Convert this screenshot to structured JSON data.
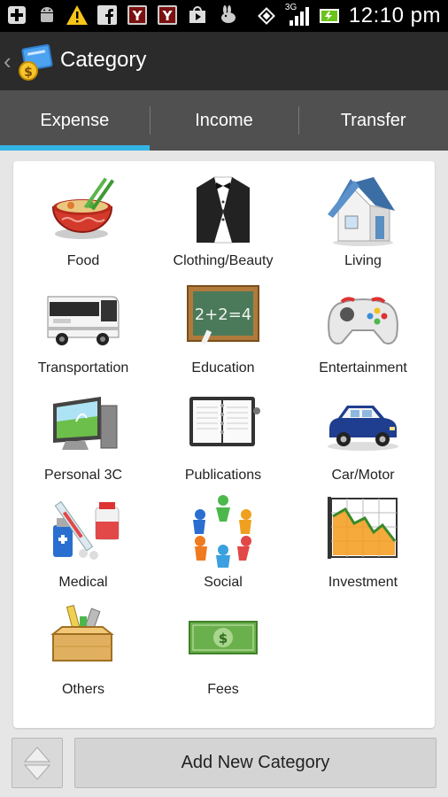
{
  "status_bar": {
    "time": "12:10 pm",
    "network": "3G",
    "left_icons": [
      "plus-icon",
      "android-icon",
      "warning-icon",
      "facebook-icon",
      "yahoo-icon",
      "yahoo-icon",
      "play-store-icon",
      "rabbit-icon"
    ],
    "right_icons": [
      "rotate-icon",
      "signal-icon",
      "battery-icon"
    ]
  },
  "action_bar": {
    "title": "Category",
    "logo": "app-logo-icon"
  },
  "tabs": [
    {
      "label": "Expense",
      "active": true
    },
    {
      "label": "Income",
      "active": false
    },
    {
      "label": "Transfer",
      "active": false
    }
  ],
  "categories": [
    {
      "label": "Food",
      "icon": "food-icon"
    },
    {
      "label": "Clothing/Beauty",
      "icon": "tuxedo-icon"
    },
    {
      "label": "Living",
      "icon": "house-icon"
    },
    {
      "label": "Transportation",
      "icon": "bus-icon"
    },
    {
      "label": "Education",
      "icon": "chalkboard-icon"
    },
    {
      "label": "Entertainment",
      "icon": "gamepad-icon"
    },
    {
      "label": "Personal 3C",
      "icon": "computer-icon"
    },
    {
      "label": "Publications",
      "icon": "notebook-icon"
    },
    {
      "label": "Car/Motor",
      "icon": "car-icon"
    },
    {
      "label": "Medical",
      "icon": "medical-icon"
    },
    {
      "label": "Social",
      "icon": "people-circle-icon"
    },
    {
      "label": "Investment",
      "icon": "chart-icon"
    },
    {
      "label": "Others",
      "icon": "box-icon"
    },
    {
      "label": "Fees",
      "icon": "money-icon"
    }
  ],
  "bottom": {
    "add_label": "Add New Category",
    "sort_icon": "sort-arrows-icon"
  },
  "colors": {
    "accent": "#33b5e5",
    "action_bar": "#2b2b2b",
    "tab_bar": "#505050"
  }
}
